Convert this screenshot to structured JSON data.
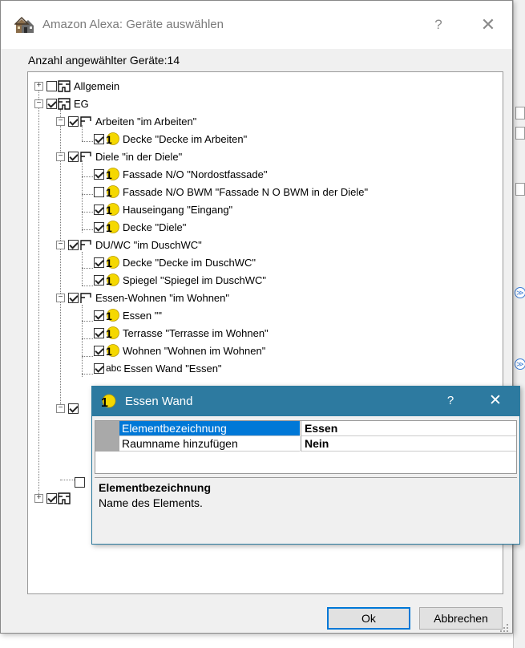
{
  "dialog": {
    "title": "Amazon Alexa: Geräte auswählen",
    "help_glyph": "?",
    "close_glyph": "✕",
    "count_label": "Anzahl angewählter Geräte:14",
    "ok_label": "Ok",
    "cancel_label": "Abbrechen"
  },
  "tree": {
    "nodes": [
      {
        "label": "Allgemein",
        "icon": "building-icon",
        "checked": false,
        "expander": "+"
      },
      {
        "label": "EG",
        "icon": "building-icon",
        "checked": true,
        "expander": "−"
      },
      {
        "label": "Arbeiten \"im Arbeiten\"",
        "icon": "room-icon",
        "checked": true,
        "expander": "−"
      },
      {
        "label": "Decke \"Decke im Arbeiten\"",
        "icon": "light-icon",
        "checked": true
      },
      {
        "label": "Diele \"in der Diele\"",
        "icon": "room-icon",
        "checked": true,
        "expander": "−"
      },
      {
        "label": "Fassade N/O \"Nordostfassade\"",
        "icon": "light-icon",
        "checked": true
      },
      {
        "label": "Fassade N/O BWM \"Fassade N O BWM in der Diele\"",
        "icon": "light-icon",
        "checked": false
      },
      {
        "label": "Hauseingang \"Eingang\"",
        "icon": "light-icon",
        "checked": true
      },
      {
        "label": "Decke \"Diele\"",
        "icon": "light-icon",
        "checked": true
      },
      {
        "label": "DU/WC \"im DuschWC\"",
        "icon": "room-icon",
        "checked": true,
        "expander": "−"
      },
      {
        "label": "Decke \"Decke im DuschWC\"",
        "icon": "light-icon",
        "checked": true
      },
      {
        "label": "Spiegel \"Spiegel im DuschWC\"",
        "icon": "light-icon",
        "checked": true
      },
      {
        "label": "Essen-Wohnen \"im Wohnen\"",
        "icon": "room-icon",
        "checked": true,
        "expander": "−"
      },
      {
        "label": "Essen \"\"",
        "icon": "light-icon",
        "checked": true
      },
      {
        "label": "Terrasse \"Terrasse im Wohnen\"",
        "icon": "light-icon",
        "checked": true
      },
      {
        "label": "Wohnen \"Wohnen im Wohnen\"",
        "icon": "light-icon",
        "checked": true
      },
      {
        "label": "Essen Wand \"Essen\"",
        "icon": "abc-icon",
        "icon_text": "abc",
        "checked": true
      },
      {
        "label": "",
        "icon": "",
        "checked": true,
        "expander": "−"
      },
      {
        "label": "",
        "icon": "",
        "checked": false
      },
      {
        "label": "",
        "icon": "building-icon",
        "checked": true,
        "expander": "+"
      }
    ]
  },
  "properties_dialog": {
    "title": "Essen Wand",
    "help_glyph": "?",
    "close_glyph": "✕",
    "rows": [
      {
        "name": "Elementbezeichnung",
        "value": "Essen"
      },
      {
        "name": "Raumname hinzufügen",
        "value": "Nein"
      }
    ],
    "description_title": "Elementbezeichnung",
    "description_text": "Name des Elements."
  },
  "background": {
    "chevron_glyph": "≫"
  }
}
